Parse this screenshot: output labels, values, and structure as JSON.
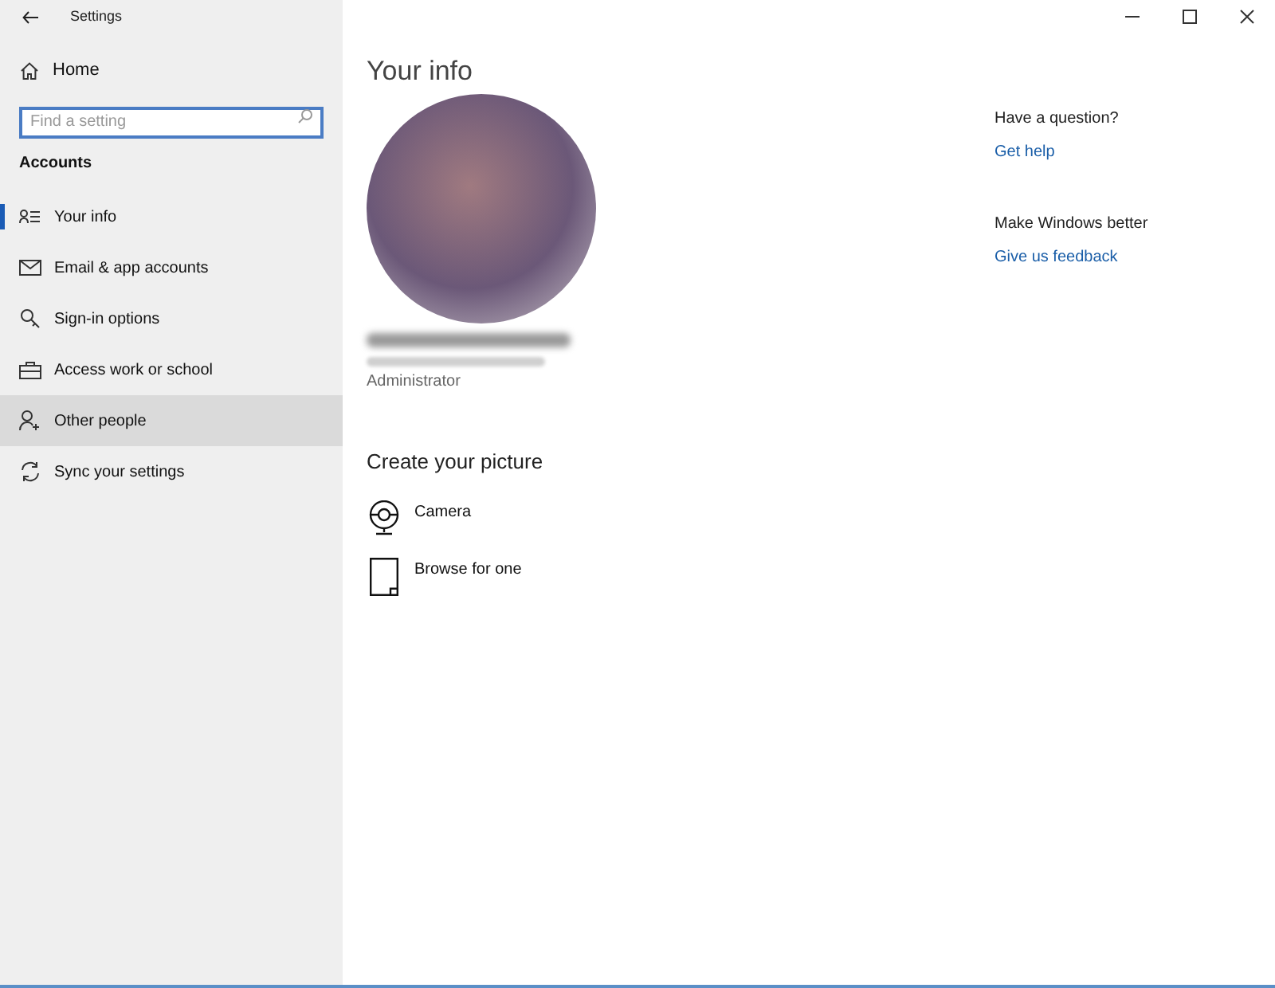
{
  "window": {
    "title": "Settings"
  },
  "sidebar": {
    "home": "Home",
    "search": {
      "placeholder": "Find a setting"
    },
    "section": "Accounts",
    "items": [
      {
        "label": "Your info",
        "selected": true,
        "hovered": false
      },
      {
        "label": "Email & app accounts",
        "selected": false,
        "hovered": false
      },
      {
        "label": "Sign-in options",
        "selected": false,
        "hovered": false
      },
      {
        "label": "Access work or school",
        "selected": false,
        "hovered": false
      },
      {
        "label": "Other people",
        "selected": false,
        "hovered": true
      },
      {
        "label": "Sync your settings",
        "selected": false,
        "hovered": false
      }
    ]
  },
  "main": {
    "title": "Your info",
    "account": {
      "role": "Administrator"
    },
    "picture_heading": "Create your picture",
    "picture_options": [
      {
        "label": "Camera"
      },
      {
        "label": "Browse for one"
      }
    ]
  },
  "aside": [
    {
      "heading": "Have a question?",
      "link": "Get help"
    },
    {
      "heading": "Make Windows better",
      "link": "Give us feedback"
    }
  ]
}
